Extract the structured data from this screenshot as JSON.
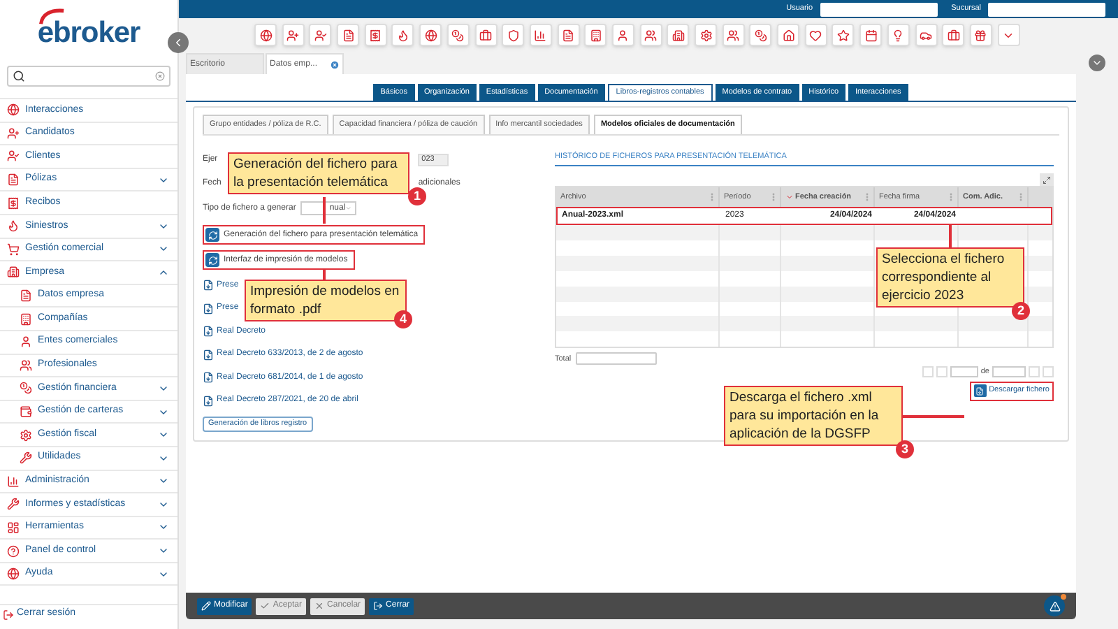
{
  "logo": "ebroker",
  "top_bar": {
    "user_label": "Usuario",
    "branch_label": "Sucursal"
  },
  "sidebar": {
    "items": [
      {
        "label": "Interacciones",
        "kind": "link"
      },
      {
        "label": "Candidatos",
        "kind": "link"
      },
      {
        "label": "Clientes",
        "kind": "link"
      },
      {
        "label": "Pólizas",
        "kind": "group",
        "expanded": false
      },
      {
        "label": "Recibos",
        "kind": "link"
      },
      {
        "label": "Siniestros",
        "kind": "group",
        "expanded": false
      },
      {
        "label": "Gestión comercial",
        "kind": "group",
        "expanded": false
      },
      {
        "label": "Empresa",
        "kind": "group",
        "expanded": true,
        "children": [
          {
            "label": "Datos empresa",
            "kind": "link"
          },
          {
            "label": "Compañías",
            "kind": "link"
          },
          {
            "label": "Entes comerciales",
            "kind": "link"
          },
          {
            "label": "Profesionales",
            "kind": "link"
          },
          {
            "label": "Gestión financiera",
            "kind": "group",
            "expanded": false
          },
          {
            "label": "Gestión de carteras",
            "kind": "group",
            "expanded": false
          },
          {
            "label": "Gestión fiscal",
            "kind": "group",
            "expanded": false
          },
          {
            "label": "Utilidades",
            "kind": "group",
            "expanded": false
          }
        ]
      },
      {
        "label": "Administración",
        "kind": "group",
        "expanded": false
      },
      {
        "label": "Informes y estadísticas",
        "kind": "group",
        "expanded": false
      },
      {
        "label": "Herramientas",
        "kind": "group",
        "expanded": false
      },
      {
        "label": "Panel de control",
        "kind": "group",
        "expanded": false
      },
      {
        "label": "Ayuda",
        "kind": "group",
        "expanded": false
      }
    ],
    "logout": "Cerrar sesión"
  },
  "doc_tabs": [
    {
      "label": "Escritorio",
      "selected": false,
      "closable": false
    },
    {
      "label": "Datos emp...",
      "selected": true,
      "closable": true
    }
  ],
  "section_tabs": [
    {
      "label": "Básicos",
      "selected": false
    },
    {
      "label": "Organización",
      "selected": false
    },
    {
      "label": "Estadísticas",
      "selected": false
    },
    {
      "label": "Documentación",
      "selected": false
    },
    {
      "label": "Libros-registros contables",
      "selected": true
    },
    {
      "label": "Modelos de contrato",
      "selected": false
    },
    {
      "label": "Histórico",
      "selected": false
    },
    {
      "label": "Interacciones",
      "selected": false
    }
  ],
  "sub_tabs": [
    {
      "label": "Grupo entidades / póliza de R.C.",
      "selected": false
    },
    {
      "label": "Capacidad financiera / póliza de caución",
      "selected": false
    },
    {
      "label": "Info mercantil sociedades",
      "selected": false
    },
    {
      "label": "Modelos oficiales de documentación",
      "selected": true
    }
  ],
  "form": {
    "year_label": "Ejer",
    "year_value": "023",
    "date_label": "Fech",
    "extra_text": "adicionales",
    "type_label": "Tipo de fichero a generar",
    "type_value": "nual"
  },
  "actions": [
    {
      "label": "Generación del fichero para presentación telemática",
      "highlighted": true
    },
    {
      "label": "Interfaz de impresión de modelos",
      "highlighted": true
    }
  ],
  "links": [
    "Prese",
    "Prese",
    "Real Decreto",
    "Real Decreto 633/2013, de 2 de agosto",
    "Real Decreto 681/2014, de 1 de agosto",
    "Real Decreto 287/2021, de 20 de abril"
  ],
  "books_button": "Generación de libros registro",
  "history": {
    "title": "HISTÓRICO DE FICHEROS PARA PRESENTACIÓN TELEMÁTICA",
    "columns": [
      {
        "label": "Archivo",
        "sorted": false,
        "bold": false
      },
      {
        "label": "Período",
        "sorted": false,
        "bold": false
      },
      {
        "label": "Fecha creación",
        "sorted": true,
        "bold": true
      },
      {
        "label": "Fecha firma",
        "sorted": false,
        "bold": false
      },
      {
        "label": "Com. Adic.",
        "sorted": false,
        "bold": true
      }
    ],
    "rows": [
      {
        "cells": [
          "Anual-2023.xml",
          "2023",
          "24/04/2024",
          "24/04/2024",
          ""
        ],
        "highlighted": true
      }
    ],
    "total_label": "Total",
    "pager_of": "de",
    "download_button": "Descargar fichero",
    "download_highlighted": true
  },
  "callouts": [
    {
      "number": "1",
      "text": "Generación del fichero para la presentación telemática"
    },
    {
      "number": "2",
      "text": "Selecciona el fichero correspondiente al ejercicio 2023"
    },
    {
      "number": "3",
      "text": "Descarga el fichero .xml para su importación en la aplicación de la DGSFP"
    },
    {
      "number": "4",
      "text": "Impresión de modelos en formato .pdf"
    }
  ],
  "bottom_bar": {
    "buttons": [
      {
        "label": "Modificar",
        "kind": "edit",
        "disabled": false
      },
      {
        "label": "Aceptar",
        "kind": "accept",
        "disabled": true
      },
      {
        "label": "Cancelar",
        "kind": "cancel",
        "disabled": true
      },
      {
        "label": "Cerrar",
        "kind": "close",
        "disabled": false
      }
    ]
  }
}
